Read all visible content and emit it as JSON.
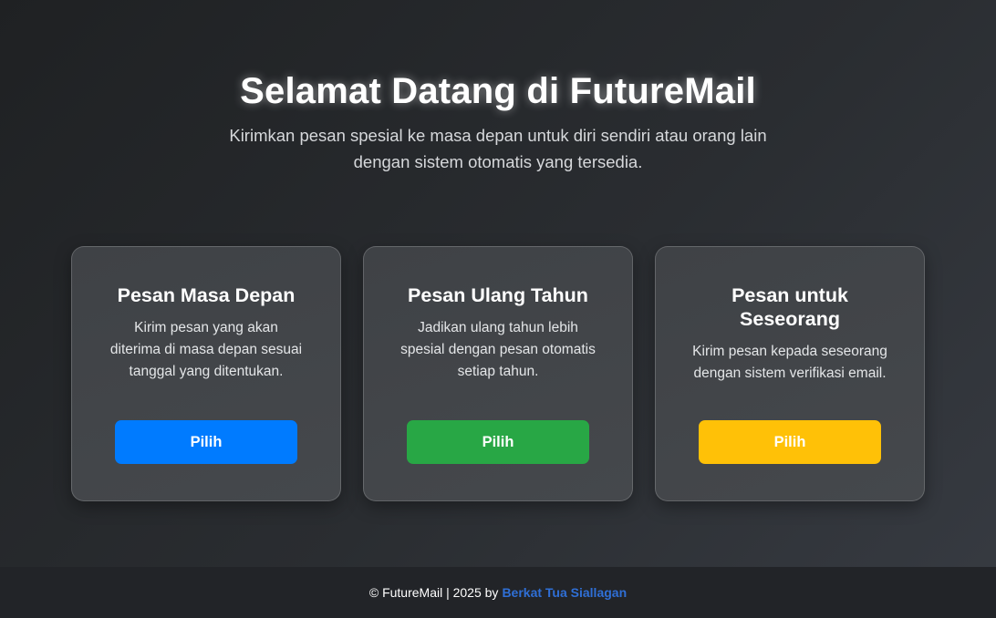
{
  "hero": {
    "title": "Selamat Datang di FutureMail",
    "subtitle": "Kirimkan pesan spesial ke masa depan untuk diri sendiri atau orang lain dengan sistem otomatis yang tersedia."
  },
  "cards": [
    {
      "title": "Pesan Masa Depan",
      "description": "Kirim pesan yang akan diterima di masa depan sesuai tanggal yang ditentukan.",
      "button_label": "Pilih",
      "button_color": "#007bff"
    },
    {
      "title": "Pesan Ulang Tahun",
      "description": "Jadikan ulang tahun lebih spesial dengan pesan otomatis setiap tahun.",
      "button_label": "Pilih",
      "button_color": "#28a745"
    },
    {
      "title": "Pesan untuk Seseorang",
      "description": "Kirim pesan kepada seseorang dengan sistem verifikasi email.",
      "button_label": "Pilih",
      "button_color": "#ffc107"
    }
  ],
  "footer": {
    "text": "© FutureMail | 2025 by",
    "author_link": "Berkat Tua Siallagan",
    "link_color": "#2f6fd6"
  }
}
